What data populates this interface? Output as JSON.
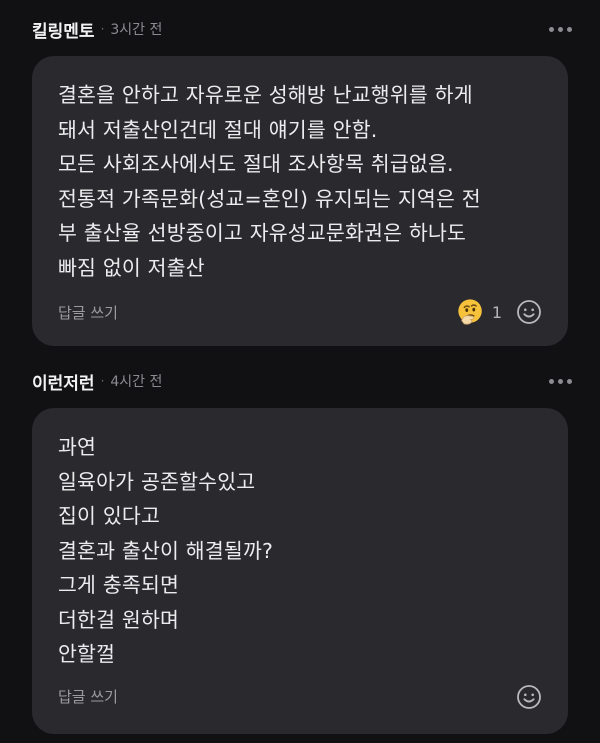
{
  "comments": [
    {
      "author": "킬링멘토",
      "separator": "·",
      "time": "3시간 전",
      "body": "결혼을 안하고 자유로운 성해방 난교행위를 하게\n돼서 저출산인건데 절대 얘기를 안함.\n모든 사회조사에서도 절대 조사항목 취급없음.\n전통적 가족문화(성교=혼인) 유지되는 지역은 전\n부 출산율 선방중이고 자유성교문화권은 하나도\n빠짐 없이 저출산",
      "reply_label": "답글 쓰기",
      "reaction": {
        "icon": "thinking-face-icon",
        "count": "1"
      },
      "add_reaction_icon": "smiley-outline-icon",
      "more_icon": "more-dots-icon"
    },
    {
      "author": "이런저런",
      "separator": "·",
      "time": "4시간 전",
      "body": "과연\n일육아가 공존할수있고\n집이 있다고\n결혼과 출산이 해결될까?\n그게 충족되면\n더한걸 원하며\n안할껄",
      "reply_label": "답글 쓰기",
      "add_reaction_icon": "smiley-outline-icon",
      "more_icon": "more-dots-icon"
    }
  ],
  "colors": {
    "background": "#111113",
    "bubble": "#2a2a2e",
    "text": "#ececee",
    "muted": "#9a9aa0"
  }
}
